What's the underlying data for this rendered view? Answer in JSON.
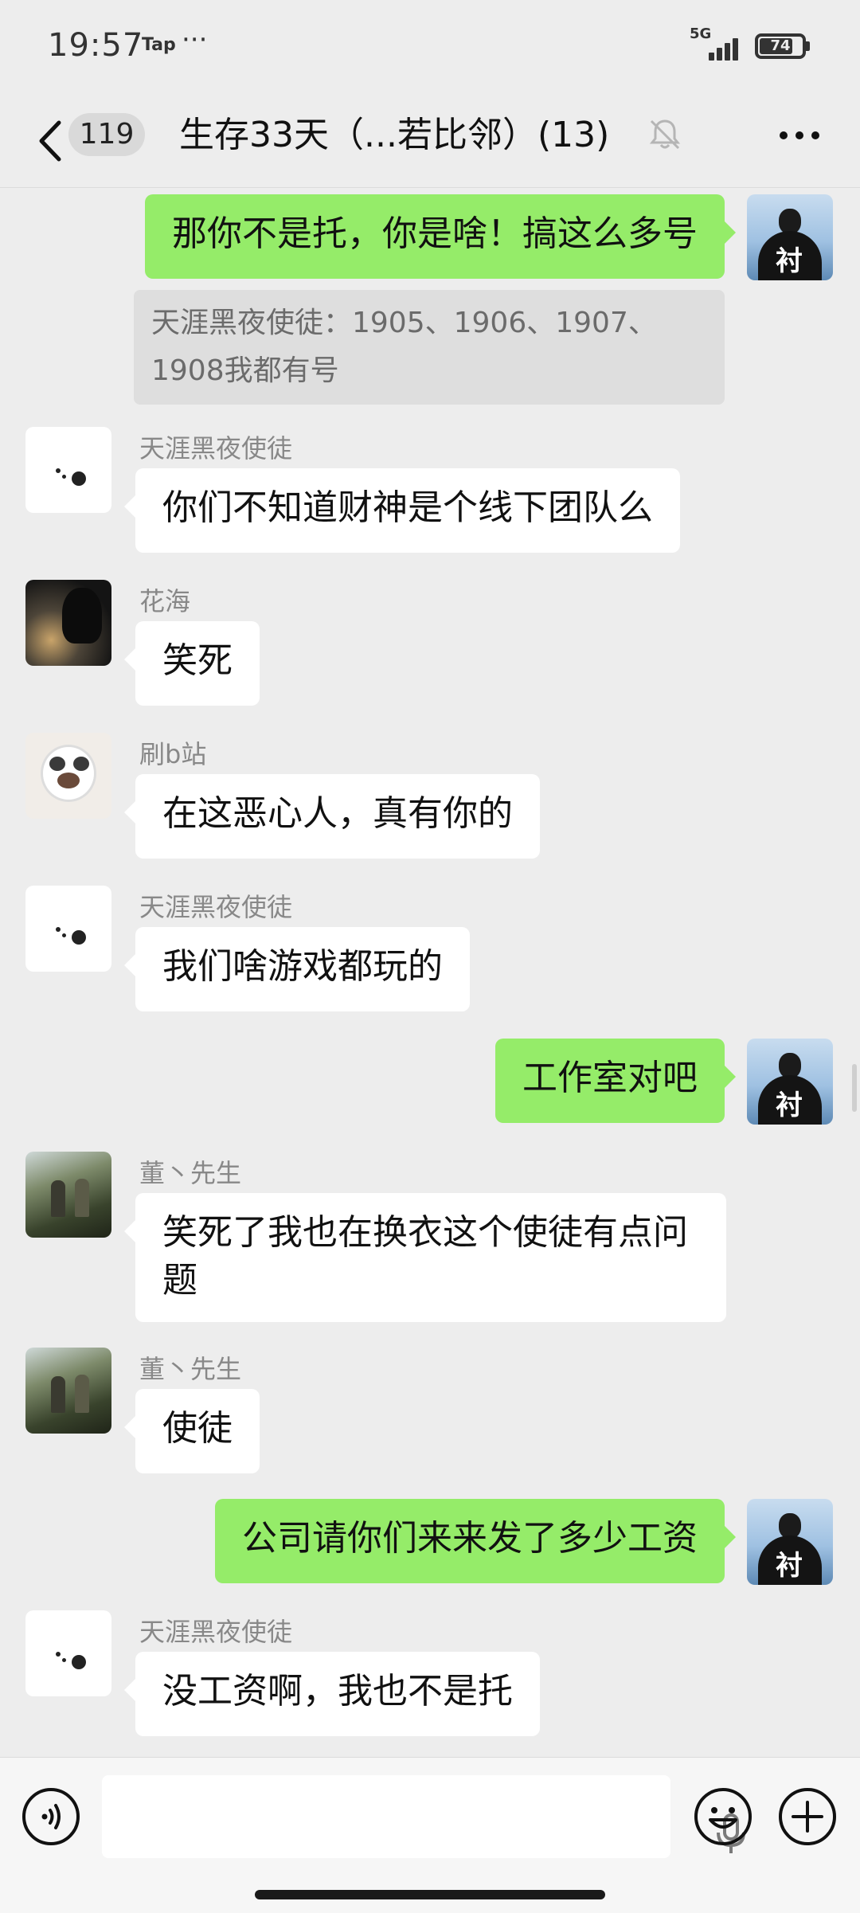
{
  "status_bar": {
    "time": "19:57",
    "app_badge": "Tap",
    "more_dots": "···",
    "network": "5G",
    "battery": "74",
    "battery_fraction": 0.74
  },
  "header": {
    "unread_count": "119",
    "title": "生存33天（...若比邻）(13)"
  },
  "messages": [
    {
      "side": "out",
      "text": "那你不是托，你是啥！搞这么多号",
      "quote": "天涯黑夜使徒：1905、1906、1907、1908我都有号"
    },
    {
      "side": "in",
      "sender": "天涯黑夜使徒",
      "text": "你们不知道财神是个线下团队么"
    },
    {
      "side": "in",
      "sender": "花海",
      "text": "笑死"
    },
    {
      "side": "in",
      "sender": "刷b站",
      "text": "在这恶心人，真有你的"
    },
    {
      "side": "in",
      "sender": "天涯黑夜使徒",
      "text": "我们啥游戏都玩的"
    },
    {
      "side": "out",
      "text": "工作室对吧"
    },
    {
      "side": "in",
      "sender": "董丶先生",
      "text": "笑死了我也在换衣这个使徒有点问题"
    },
    {
      "side": "in",
      "sender": "董丶先生",
      "text": "使徒"
    },
    {
      "side": "out",
      "text": "公司请你们来来发了多少工资"
    },
    {
      "side": "in",
      "sender": "天涯黑夜使徒",
      "text": "没工资啊，我也不是托"
    }
  ],
  "icons": {
    "back": "back-arrow-icon",
    "mute": "bell-off-icon",
    "more": "more-dots-icon",
    "voice": "voice-icon",
    "mic": "mic-icon",
    "emoji": "emoji-icon",
    "plus": "plus-icon"
  },
  "colors": {
    "outgoing_bubble": "#95ec69",
    "incoming_bubble": "#ffffff",
    "background": "#ededed"
  }
}
